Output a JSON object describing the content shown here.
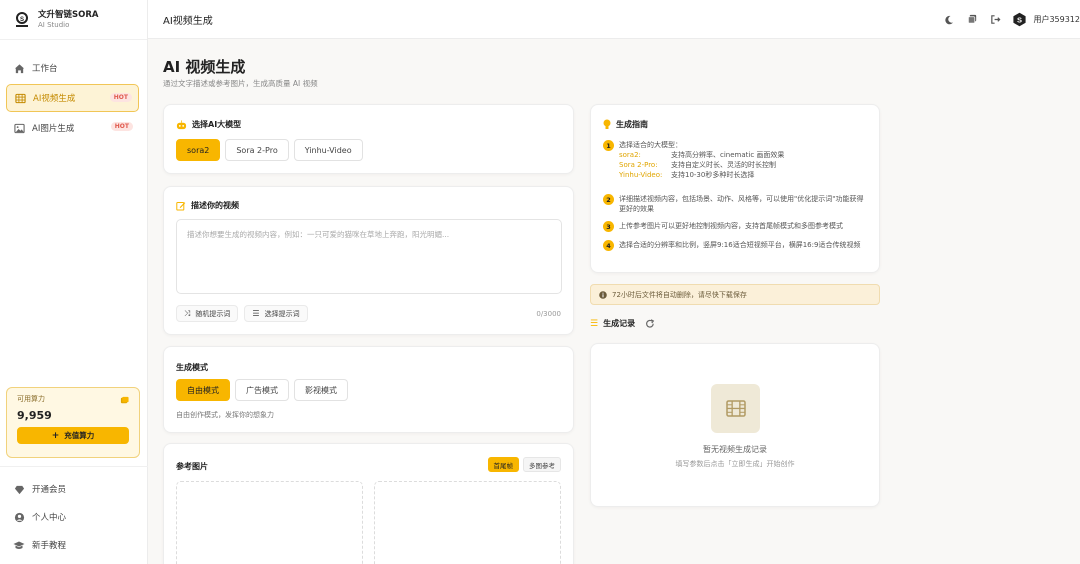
{
  "brand": {
    "name": "文升智链SORA",
    "subtitle": "AI Studio"
  },
  "sidebar": {
    "items": [
      {
        "label": "工作台",
        "icon": "home-icon"
      },
      {
        "label": "AI视频生成",
        "icon": "video-icon",
        "badge": "HOT",
        "active": true
      },
      {
        "label": "AI图片生成",
        "icon": "image-icon",
        "badge": "HOT"
      }
    ],
    "credits": {
      "label": "可用算力",
      "value": "9,959",
      "button": "充值算力",
      "button_prefix": "+"
    },
    "bottom_items": [
      {
        "label": "开通会员",
        "icon": "diamond-icon"
      },
      {
        "label": "个人中心",
        "icon": "user-icon"
      },
      {
        "label": "新手教程",
        "icon": "graduation-cap-icon"
      }
    ]
  },
  "topbar": {
    "title": "AI视频生成",
    "user": "用户359312"
  },
  "page": {
    "title": "AI 视频生成",
    "subtitle": "通过文字描述或参考图片，生成高质量 AI 视频"
  },
  "model": {
    "heading": "选择AI大模型",
    "options": [
      "sora2",
      "Sora 2-Pro",
      "Yinhu-Video"
    ],
    "selected": "sora2"
  },
  "describe": {
    "heading": "描述你的视频",
    "placeholder": "描述你想要生成的视频内容，例如：一只可爱的猫咪在草地上奔跑，阳光明媚...",
    "random_btn": "随机提示词",
    "pick_btn": "选择提示词",
    "counter": "0/3000"
  },
  "mode": {
    "heading": "生成模式",
    "options": [
      "自由模式",
      "广告模式",
      "影视模式"
    ],
    "selected": "自由模式",
    "description": "自由创作模式，发挥你的想象力"
  },
  "reference": {
    "heading": "参考图片",
    "tabs": [
      "首尾帧",
      "多图参考"
    ],
    "selected": "首尾帧"
  },
  "guide": {
    "heading": "生成指南",
    "step1_title": "选择适合的大模型：",
    "models": [
      {
        "name": "sora2:",
        "desc": "支持高分辨率、cinematic 画面效果"
      },
      {
        "name": "Sora 2-Pro:",
        "desc": "支持自定义时长、灵活的时长控制"
      },
      {
        "name": "Yinhu-Video:",
        "desc": "支持10-30秒多种时长选择"
      }
    ],
    "steps": [
      "详细描述视频内容，包括场景、动作、风格等，可以使用\"优化提示词\"功能获得更好的效果",
      "上传参考图片可以更好地控制视频内容，支持首尾帧模式和多图参考模式",
      "选择合适的分辨率和比例，竖屏9:16适合短视频平台，横屏16:9适合传统视频"
    ]
  },
  "notice": "72小时后文件将自动删除，请尽快下载保存",
  "history": {
    "heading": "生成记录",
    "empty_title": "暂无视频生成记录",
    "empty_sub": "填写参数后点击「立即生成」开始创作"
  },
  "colors": {
    "accent": "#f8b600",
    "accent_light": "#fdf3d6",
    "hot": "#e05a4e"
  }
}
